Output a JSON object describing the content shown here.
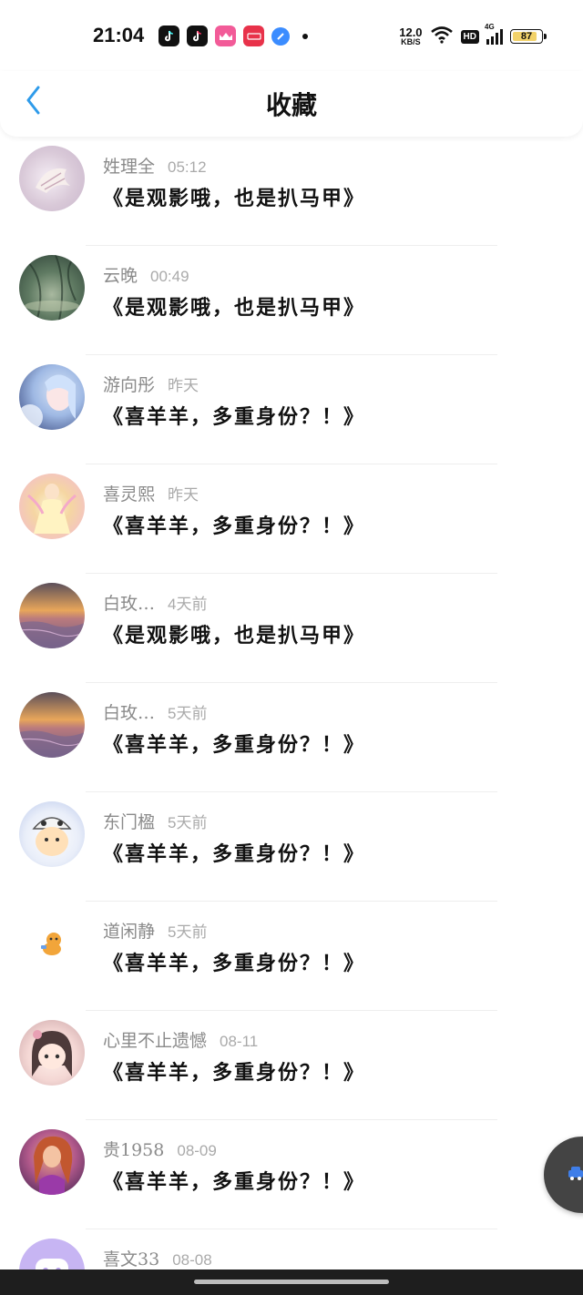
{
  "status_bar": {
    "time": "21:04",
    "net_speed_value": "12.0",
    "net_speed_unit": "KB/S",
    "hd_label": "HD",
    "signal_label": "4G",
    "battery": "87"
  },
  "header": {
    "title": "收藏"
  },
  "items": [
    {
      "name": "姓理全",
      "time": "05:12",
      "message": "《是观影哦，也是扒马甲》",
      "avatar": "shell"
    },
    {
      "name": "云晚",
      "time": "00:49",
      "message": "《是观影哦，也是扒马甲》",
      "avatar": "bamboo"
    },
    {
      "name": "游向彤",
      "time": "昨天",
      "message": "《喜羊羊，多重身份？！》",
      "avatar": "girl"
    },
    {
      "name": "喜灵熙",
      "time": "昨天",
      "message": "《喜羊羊，多重身份？！》",
      "avatar": "fairy"
    },
    {
      "name": "白玫…",
      "time": "4天前",
      "message": "《是观影哦，也是扒马甲》",
      "avatar": "sunset"
    },
    {
      "name": "白玫…",
      "time": "5天前",
      "message": "《喜羊羊，多重身份？！》",
      "avatar": "sunset"
    },
    {
      "name": "东门楹",
      "time": "5天前",
      "message": "《喜羊羊，多重身份？！》",
      "avatar": "kid"
    },
    {
      "name": "道闲静",
      "time": "5天前",
      "message": "《喜羊羊，多重身份？！》",
      "avatar": "blank"
    },
    {
      "name": "心里不止遗憾",
      "time": "08-11",
      "message": "《喜羊羊，多重身份？！》",
      "avatar": "anime"
    },
    {
      "name": "贵1958",
      "time": "08-09",
      "message": "《喜羊羊，多重身份？！》",
      "avatar": "mermaid"
    },
    {
      "name": "喜文33",
      "time": "08-08",
      "message": "",
      "avatar": "purple"
    }
  ]
}
